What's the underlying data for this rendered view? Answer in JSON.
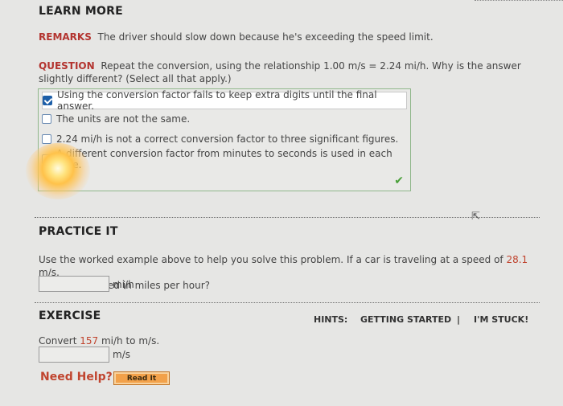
{
  "learn_more": {
    "title": "LEARN MORE"
  },
  "remarks": {
    "label": "REMARKS",
    "text": "The driver should slow down because he's exceeding the speed limit."
  },
  "question": {
    "label": "QUESTION",
    "line1": "Repeat the conversion, using the relationship 1.00 m/s = 2.24 mi/h. Why is the answer",
    "line2": "slightly different? (Select all that apply.)",
    "options": [
      {
        "text": "Using the conversion factor fails to keep extra digits until the final answer.",
        "checked": true
      },
      {
        "text": "The units are not the same.",
        "checked": false
      },
      {
        "text": "2.24 mi/h is not a correct conversion factor to three significant figures.",
        "checked": false
      },
      {
        "text": "A different conversion factor from minutes to seconds is used in each case.",
        "checked": false
      }
    ]
  },
  "practice": {
    "title": "PRACTICE IT",
    "line1_pre": "Use the worked example above to help you solve this problem. If a car is traveling at a speed of ",
    "speed": "28.1",
    "line1_post": " m/s,",
    "line2": "what is its speed in miles per hour?",
    "unit": "mi/h",
    "answer": ""
  },
  "exercise": {
    "title": "EXERCISE",
    "prompt_pre": "Convert ",
    "value": "157",
    "prompt_post": " mi/h to m/s.",
    "unit": "m/s",
    "answer": ""
  },
  "hints": {
    "label": "HINTS:",
    "getting_started": "GETTING STARTED",
    "separator": "|",
    "stuck": "I'M STUCK!"
  },
  "help": {
    "need_help": "Need Help?",
    "read_it": "Read It"
  },
  "colors": {
    "accent_red": "#b3342f",
    "link_orange": "#c0442e",
    "check_green": "#4aa03a",
    "checkbox_blue": "#1e5fa8"
  }
}
